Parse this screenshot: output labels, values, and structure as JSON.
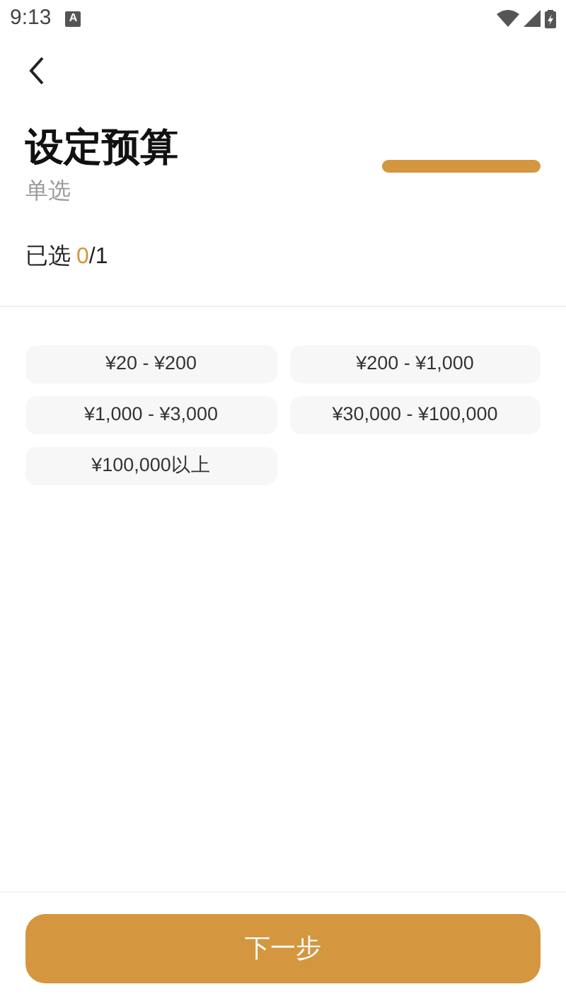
{
  "status_bar": {
    "time": "9:13",
    "notification_icon": "A"
  },
  "header": {
    "title": "设定预算",
    "subtitle": "单选"
  },
  "selection": {
    "label": "已选",
    "count": "0",
    "total": "/1"
  },
  "options": [
    {
      "label": "¥20 - ¥200",
      "selected": false
    },
    {
      "label": "¥200 - ¥1,000",
      "selected": false
    },
    {
      "label": "¥1,000 - ¥3,000",
      "selected": false
    },
    {
      "label": "¥30,000 - ¥100,000",
      "selected": false
    },
    {
      "label": "¥100,000以上",
      "selected": false
    }
  ],
  "next_button": {
    "label": "下一步"
  }
}
